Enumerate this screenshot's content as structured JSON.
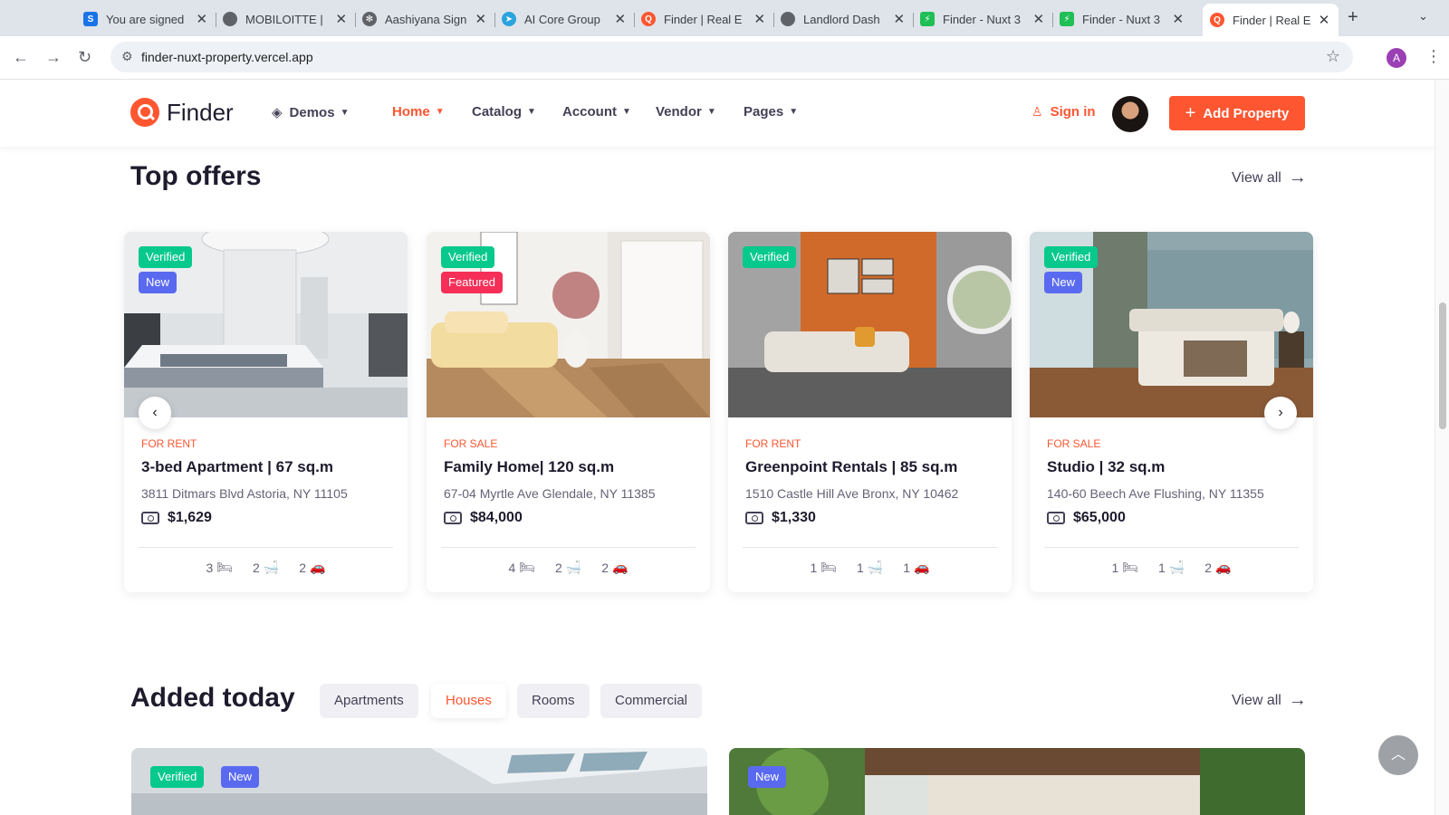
{
  "browser": {
    "tabs": [
      {
        "title": "You are signed",
        "favicon": "S",
        "color": "#1a73e8"
      },
      {
        "title": "MOBILOITTE |",
        "favicon": "globe",
        "color": "#5f6368"
      },
      {
        "title": "Aashiyana Sign",
        "favicon": "gear",
        "color": "#5f6368"
      },
      {
        "title": "AI Core Group",
        "favicon": "telegram",
        "color": "#2aa3df"
      },
      {
        "title": "Finder | Real E",
        "favicon": "finder",
        "color": "#fd5631"
      },
      {
        "title": "Landlord Dash",
        "favicon": "globe",
        "color": "#5f6368"
      },
      {
        "title": "Finder - Nuxt 3",
        "favicon": "nuxt",
        "color": "#1fbf55"
      },
      {
        "title": "Finder - Nuxt 3",
        "favicon": "nuxt",
        "color": "#1fbf55"
      },
      {
        "title": "Finder | Real E",
        "favicon": "finder",
        "color": "#fd5631"
      }
    ],
    "url": "finder-nuxt-property.vercel.app",
    "profile_initial": "A"
  },
  "header": {
    "logo": "Finder",
    "menu": [
      "Demos",
      "Home",
      "Catalog",
      "Account",
      "Vendor",
      "Pages"
    ],
    "active_menu": "Home",
    "signin": "Sign in",
    "add_property": "Add Property"
  },
  "top_offers": {
    "title": "Top offers",
    "view_all": "View all",
    "cards": [
      {
        "badges": [
          "Verified",
          "New"
        ],
        "type": "FOR RENT",
        "name": "3-bed Apartment | 67 sq.m",
        "address": "3811 Ditmars Blvd Astoria, NY 11105",
        "price": "$1,629",
        "beds": "3",
        "baths": "2",
        "cars": "2"
      },
      {
        "badges": [
          "Verified",
          "Featured"
        ],
        "type": "FOR SALE",
        "name": "Family Home| 120 sq.m",
        "address": "67-04 Myrtle Ave Glendale, NY 11385",
        "price": "$84,000",
        "beds": "4",
        "baths": "2",
        "cars": "2"
      },
      {
        "badges": [
          "Verified"
        ],
        "type": "FOR RENT",
        "name": "Greenpoint Rentals | 85 sq.m",
        "address": "1510 Castle Hill Ave Bronx, NY 10462",
        "price": "$1,330",
        "beds": "1",
        "baths": "1",
        "cars": "1"
      },
      {
        "badges": [
          "Verified",
          "New"
        ],
        "type": "FOR SALE",
        "name": "Studio | 32 sq.m",
        "address": "140-60 Beech Ave Flushing, NY 11355",
        "price": "$65,000",
        "beds": "1",
        "baths": "1",
        "cars": "2"
      }
    ]
  },
  "added_today": {
    "title": "Added today",
    "filters": [
      "Apartments",
      "Houses",
      "Rooms",
      "Commercial"
    ],
    "active_filter": "Houses",
    "view_all": "View all",
    "cards": [
      {
        "badges": [
          "Verified",
          "New"
        ]
      },
      {
        "badges": [
          "New"
        ]
      }
    ]
  },
  "colors": {
    "accent": "#fd5631",
    "verified": "#07c98b",
    "new": "#5a6af0",
    "featured": "#f52f57"
  }
}
